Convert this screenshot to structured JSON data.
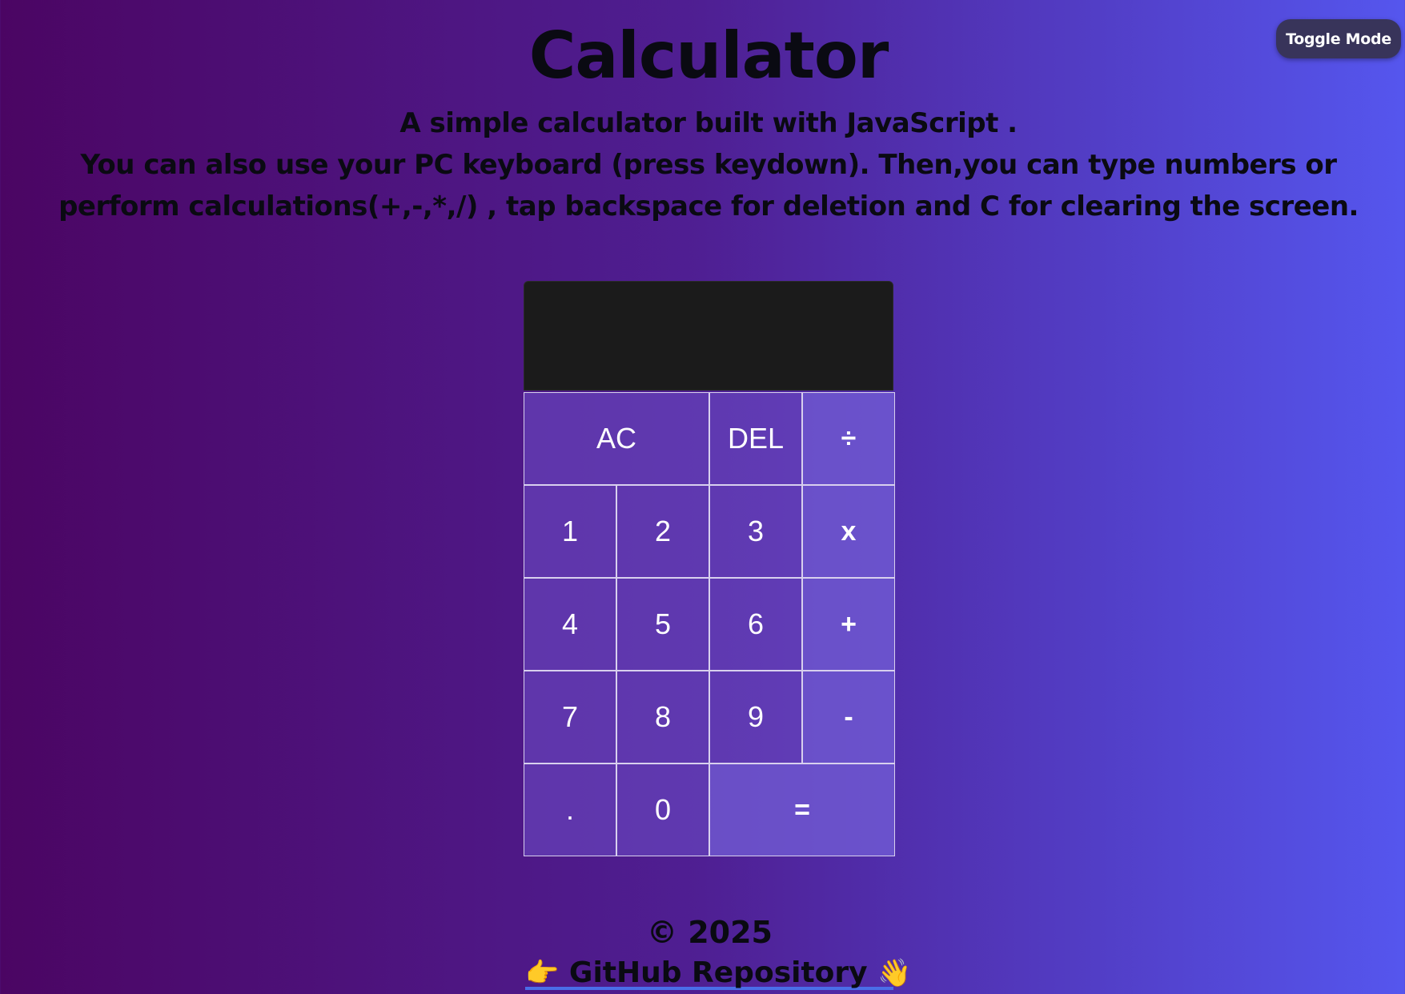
{
  "header": {
    "toggle_label": "Toggle Mode",
    "title": "Calculator",
    "subtitle_line1": "A simple calculator built with JavaScript .",
    "subtitle_line2": "You can also use your PC keyboard (press keydown). Then,you can type numbers or perform calculations(+,-,*,/) , tap backspace for deletion and C for clearing the screen."
  },
  "calculator": {
    "display_value": "",
    "keys": {
      "ac": "AC",
      "del": "DEL",
      "divide": "÷",
      "one": "1",
      "two": "2",
      "three": "3",
      "multiply": "x",
      "four": "4",
      "five": "5",
      "six": "6",
      "plus": "+",
      "seven": "7",
      "eight": "8",
      "nine": "9",
      "minus": "-",
      "dot": ".",
      "zero": "0",
      "equals": "="
    }
  },
  "footer": {
    "copyright": "© 2025",
    "link_label": "GitHub Repository",
    "left_emoji_icon": "pointing-hand-icon",
    "right_emoji_icon": "waving-hand-icon"
  },
  "colors": {
    "gradient_start": "#4b0563",
    "gradient_end": "#5556ee",
    "display_bg": "#1b1b1b",
    "toggle_bg": "#38345a",
    "link_underline": "#4a6ee8"
  }
}
